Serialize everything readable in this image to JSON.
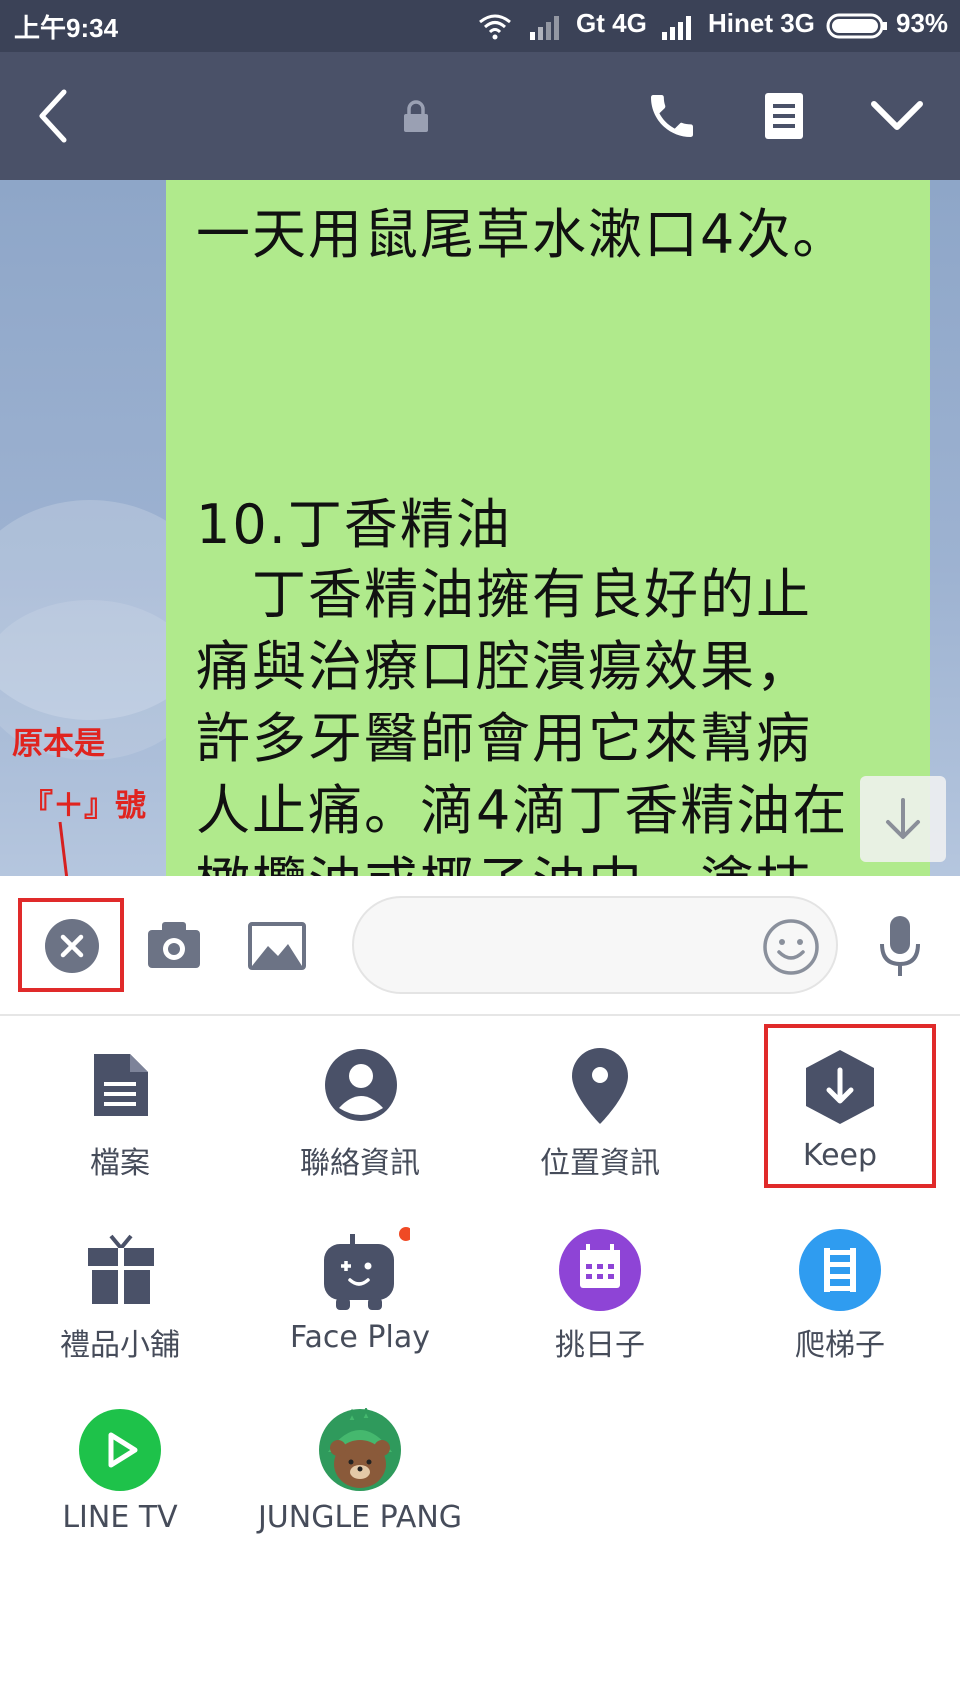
{
  "status_bar": {
    "time": "上午9:34",
    "carrier1": "Gt 4G",
    "carrier2": "Hinet 3G",
    "battery": "93%",
    "icons": [
      "wifi-icon",
      "signal-icon",
      "signal-icon",
      "battery-icon"
    ]
  },
  "header": {
    "icons": [
      "back-arrow-icon",
      "lock-icon",
      "phone-icon",
      "notes-icon",
      "chevron-down-icon"
    ]
  },
  "message": {
    "lines": [
      "一天用鼠尾草水漱口4次。",
      "10.丁香精油",
      "　丁香精油擁有良好的止",
      "痛與治療口腔潰瘍效果，",
      "許多牙醫師會用它來幫病",
      "人止痛。滴4滴丁香精油在",
      "橄欖油或椰子油中，塗抹"
    ]
  },
  "annotation": {
    "line1": "原本是",
    "line2": "『＋』號"
  },
  "input_bar": {
    "placeholder": "",
    "icons": [
      "close-icon",
      "camera-icon",
      "image-icon",
      "emoji-icon",
      "microphone-icon"
    ]
  },
  "menu": {
    "items": [
      {
        "label": "檔案",
        "icon": "file-icon"
      },
      {
        "label": "聯絡資訊",
        "icon": "contact-icon"
      },
      {
        "label": "位置資訊",
        "icon": "location-pin-icon"
      },
      {
        "label": "Keep",
        "icon": "keep-icon"
      },
      {
        "label": "禮品小舖",
        "icon": "gift-icon"
      },
      {
        "label": "Face Play",
        "icon": "face-play-icon"
      },
      {
        "label": "挑日子",
        "icon": "calendar-icon"
      },
      {
        "label": "爬梯子",
        "icon": "ladder-icon"
      },
      {
        "label": "LINE TV",
        "icon": "line-tv-icon"
      },
      {
        "label": "JUNGLE PANG",
        "icon": "jungle-pang-icon"
      }
    ]
  },
  "colors": {
    "status_bar": "#3b4257",
    "header": "#4a5168",
    "bubble": "#b0ea8c",
    "icon_dark": "#4a5168",
    "annotation_red": "#e0241f",
    "calendar_purple": "#8e44d6",
    "ladder_blue": "#2f9cf0",
    "line_tv_green": "#1ec24a",
    "notification_dot": "#f04a25"
  }
}
